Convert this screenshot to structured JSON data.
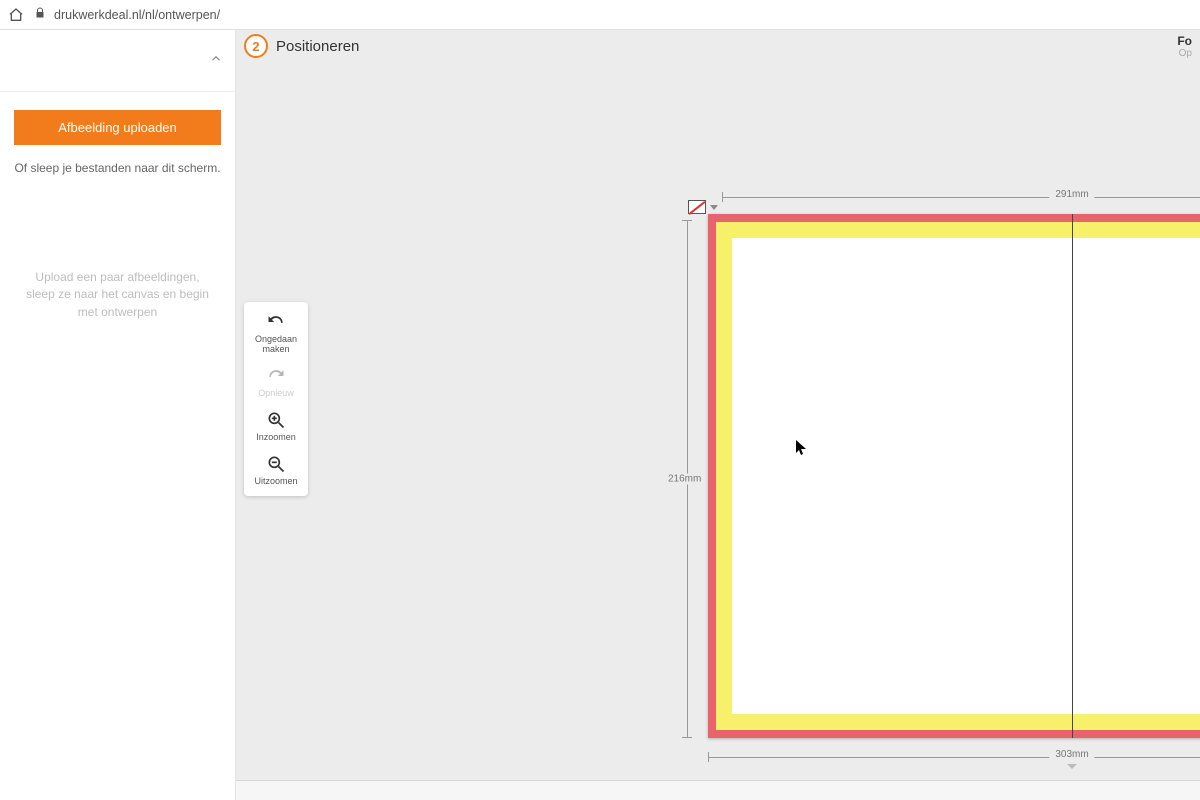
{
  "browser": {
    "url": "drukwerkdeal.nl/nl/ontwerpen/"
  },
  "step": {
    "number": "2",
    "title": "Positioneren"
  },
  "right_header": {
    "line1": "Fo",
    "line2": "Op"
  },
  "sidebar": {
    "upload_button": "Afbeelding uploaden",
    "drag_hint": "Of sleep je bestanden naar dit scherm.",
    "empty_message": "Upload een paar afbeeldingen, sleep ze naar het canvas en begin met ontwerpen"
  },
  "tools": {
    "undo": "Ongedaan maken",
    "redo": "Opnieuw",
    "zoom_in": "Inzoomen",
    "zoom_out": "Uitzoomen"
  },
  "dimensions": {
    "trim_width": "291mm",
    "trim_height": "216mm",
    "bleed_width": "303mm"
  },
  "colors": {
    "accent": "#f27c1b",
    "bleed": "#e8646c",
    "safe": "#f7f06a"
  }
}
